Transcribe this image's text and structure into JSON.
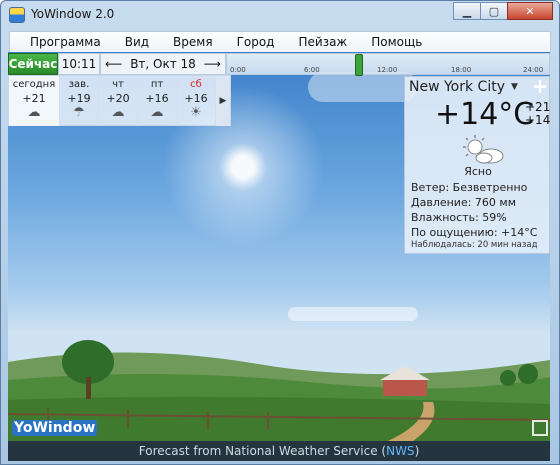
{
  "window": {
    "title": "YoWindow 2.0",
    "minimize_label": "▁",
    "maximize_label": "▢",
    "close_label": "✕"
  },
  "menu": {
    "items": [
      "Программа",
      "Вид",
      "Время",
      "Город",
      "Пейзаж",
      "Помощь"
    ]
  },
  "timebar": {
    "now_label": "Сейчас",
    "time": "10:11",
    "date": "Вт, Окт 18",
    "prev_icon": "arrow-left-icon",
    "next_icon": "arrow-right-icon",
    "ticks": [
      "0:00",
      "6:00",
      "12:00",
      "18:00",
      "24:00"
    ]
  },
  "forecast": {
    "days": [
      {
        "name": "сегодня",
        "temp": "+21",
        "icon": "cloud-icon",
        "weekend": false
      },
      {
        "name": "зав.",
        "temp": "+19",
        "icon": "rain-cloud-icon",
        "weekend": false
      },
      {
        "name": "чт",
        "temp": "+20",
        "icon": "cloud-icon",
        "weekend": false
      },
      {
        "name": "пт",
        "temp": "+16",
        "icon": "cloud-icon",
        "weekend": false
      },
      {
        "name": "сб",
        "temp": "+16",
        "icon": "sun-cloud-icon",
        "weekend": true
      }
    ],
    "more_icon": "chevron-right-icon"
  },
  "current": {
    "city": "New York City",
    "temp": "+14°C",
    "high": "+21",
    "low": "+14",
    "condition": "Ясно",
    "wind": "Ветер:  Безветренно",
    "pressure": "Давление:  760 мм",
    "humidity": "Влажность:  59%",
    "feels_like": "По ощущению:  +14°C",
    "observed": "Наблюдалась:  20 мин назад"
  },
  "footer": {
    "prefix": "Forecast from National Weather Service (",
    "source": "NWS",
    "suffix": ")"
  },
  "branding": {
    "logo": "YoWindow"
  },
  "colors": {
    "now_green": "#3da33d",
    "sky_top": "#3b7fc9",
    "footer_bg": "#243540",
    "link_blue": "#5db8ff",
    "weekend_red": "#dd2222"
  }
}
